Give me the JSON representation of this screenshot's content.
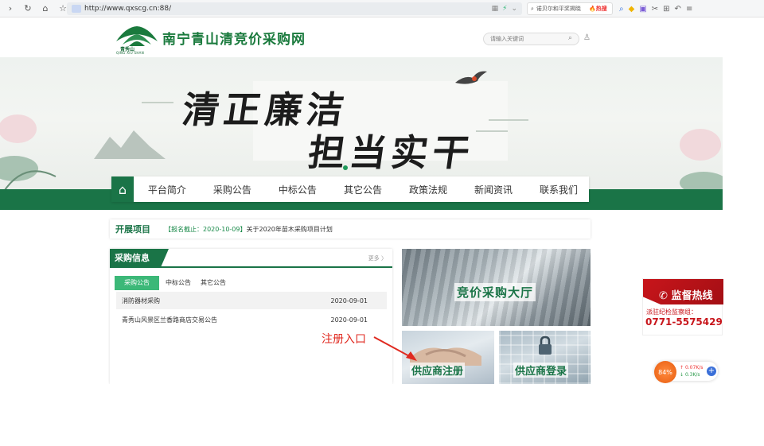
{
  "browser": {
    "url": "http://www.qxscg.cn:88/",
    "search_placeholder": "诺贝尔和平奖揭晓",
    "hot_label": "热搜"
  },
  "header": {
    "logo_text_cn": "青秀山",
    "logo_text_en": "QING XIU SHAN",
    "site_title": "南宁青山清竞价采购网",
    "search_placeholder": "请输入关键词"
  },
  "banner": {
    "line1": "清正廉洁",
    "line2": "担当实干"
  },
  "nav": {
    "items": [
      {
        "label": "平台简介"
      },
      {
        "label": "采购公告"
      },
      {
        "label": "中标公告"
      },
      {
        "label": "其它公告"
      },
      {
        "label": "政策法规"
      },
      {
        "label": "新闻资讯"
      },
      {
        "label": "联系我们"
      }
    ]
  },
  "projects": {
    "title": "开展项目",
    "deadline": "【报名截止：2020-10-09】",
    "item": "关于2020年苗木采购项目计划"
  },
  "procurement": {
    "title": "采购信息",
    "more": "更多",
    "tabs": [
      {
        "label": "采购公告"
      },
      {
        "label": "中标公告"
      },
      {
        "label": "其它公告"
      }
    ],
    "rows": [
      {
        "title": "消防器材采购",
        "date": "2020-09-01"
      },
      {
        "title": "青秀山风景区兰香路商店交易公告",
        "date": "2020-09-01"
      }
    ]
  },
  "tiles": {
    "hall": "竞价采购大厅",
    "register": "供应商注册",
    "login": "供应商登录"
  },
  "annotation": {
    "text": "注册入口"
  },
  "hotline": {
    "title": "监督热线",
    "subtitle": "派驻纪检监察组：",
    "phone": "0771-5575429"
  },
  "speed_widget": {
    "percent": "84%",
    "upload": "0.07K/s",
    "download": "0.3K/s"
  },
  "colors": {
    "brand_green": "#1a7447",
    "accent_green": "#3cb878",
    "hotline_red": "#c8151b",
    "annotation_red": "#e02a20"
  }
}
